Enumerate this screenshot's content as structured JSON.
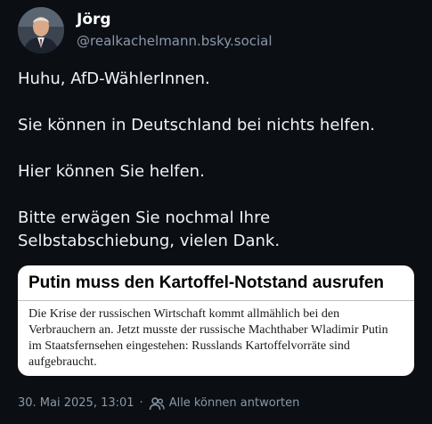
{
  "author": {
    "display_name": "Jörg",
    "handle": "@realkachelmann.bsky.social",
    "avatar_icon": "user-avatar-icon"
  },
  "post": {
    "paragraphs": [
      "Huhu, AfD-WählerInnen.",
      "Sie können in Deutschland bei nichts helfen.",
      "Hier können Sie helfen.",
      "Bitte erwägen Sie nochmal Ihre Selbstabschiebung, vielen Dank."
    ]
  },
  "quote": {
    "headline": "Putin muss den Kartoffel-Notstand ausrufen",
    "body": "Die Krise der russischen Wirtschaft kommt allmählich bei den Verbrauchern an. Jetzt musste der russische Machthaber Wladimir Putin im Staatsfernsehen eingestehen: Russlands Kartoffelvorräte sind aufgebraucht."
  },
  "footer": {
    "timestamp": "30. Mai 2025, 13:01",
    "separator": "·",
    "reply_setting": "Alle können antworten",
    "reply_icon": "people-icon"
  },
  "colors": {
    "background": "#0b0f14",
    "text": "#f1f3f5",
    "muted": "#8b98a9",
    "card": "#ffffff"
  }
}
